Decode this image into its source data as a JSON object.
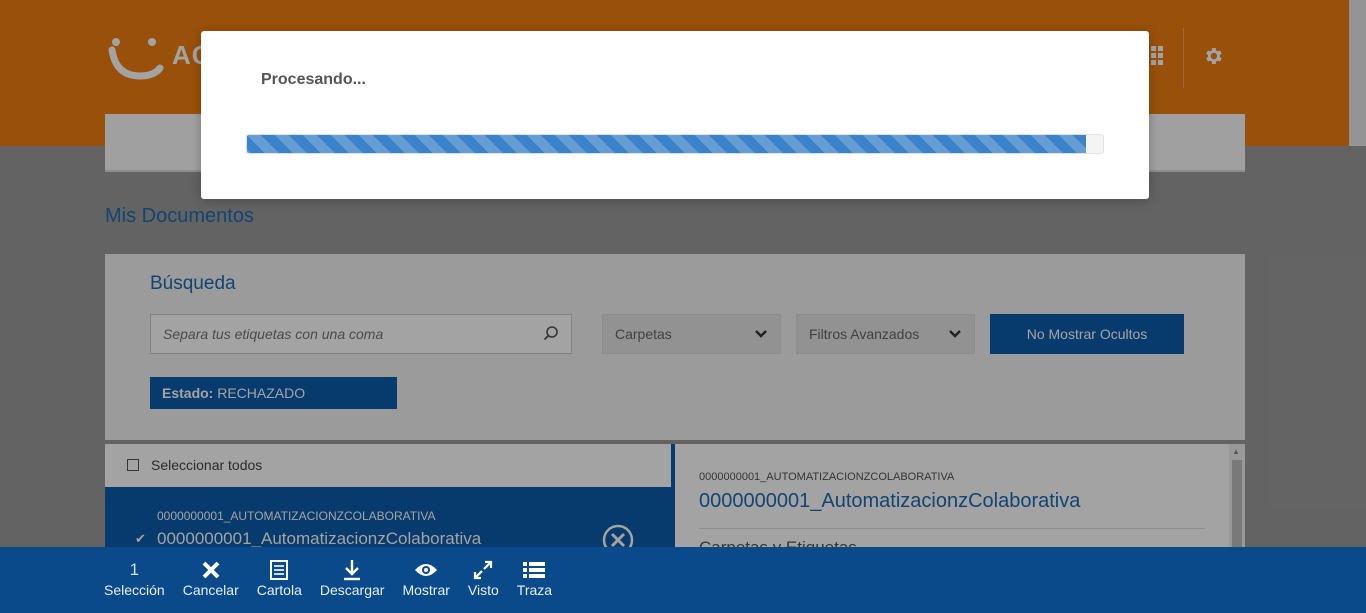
{
  "header": {
    "logo_text": "AC"
  },
  "page": {
    "title": "Mis Documentos"
  },
  "search": {
    "title": "Búsqueda",
    "placeholder": "Separa tus etiquetas con una coma",
    "folders_label": "Carpetas",
    "filters_label": "Filtros Avanzados",
    "hide_button": "No Mostrar Ocultos",
    "state_label": "Estado:",
    "state_value": "RECHAZADO"
  },
  "list": {
    "select_all": "Seleccionar todos",
    "items": [
      {
        "code": "0000000001_AUTOMATIZACIONZCOLABORATIVA",
        "name": "0000000001_AutomatizacionzColaborativa",
        "checked": true
      }
    ]
  },
  "detail": {
    "code": "0000000001_AUTOMATIZACIONZCOLABORATIVA",
    "name": "0000000001_AutomatizacionzColaborativa",
    "section": "Carpetas y Etiquetas"
  },
  "toolbar": {
    "selection_count": "1",
    "selection_label": "Selección",
    "cancel_label": "Cancelar",
    "cartola_label": "Cartola",
    "download_label": "Descargar",
    "show_label": "Mostrar",
    "seen_label": "Visto",
    "trace_label": "Traza"
  },
  "modal": {
    "title": "Procesando...",
    "progress": 0.98
  },
  "colors": {
    "header": "#f07d10",
    "primary": "#0b5cab",
    "toolbar": "#0b4a8a",
    "progress": "#3a82c9"
  }
}
